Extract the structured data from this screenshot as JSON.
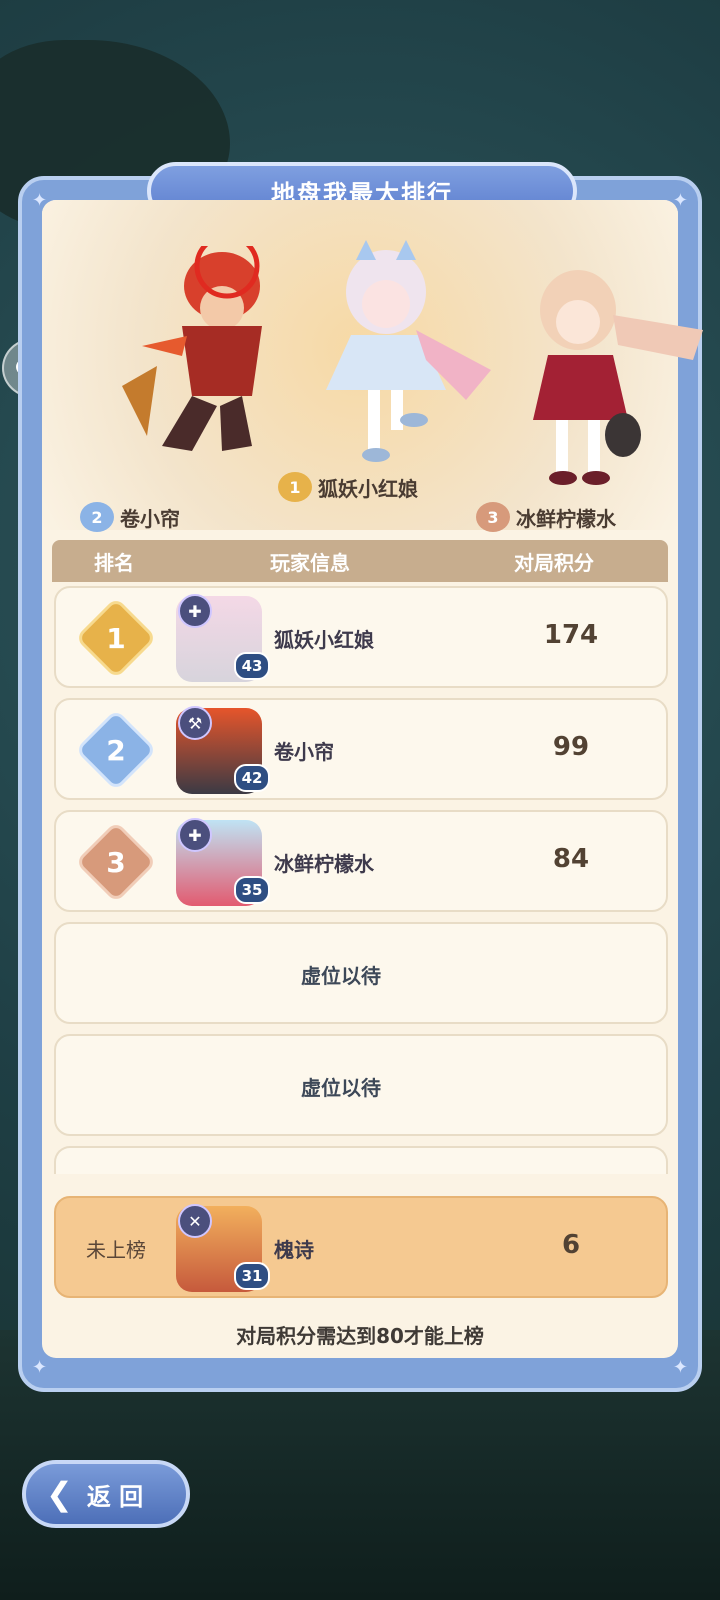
{
  "title": "地盘我最大排行",
  "podium": [
    {
      "rank": "1",
      "name": "狐妖小红娘"
    },
    {
      "rank": "2",
      "name": "卷小帘"
    },
    {
      "rank": "3",
      "name": "冰鲜柠檬水"
    }
  ],
  "table_header": {
    "rank": "排名",
    "player": "玩家信息",
    "score": "对局积分"
  },
  "rows": [
    {
      "rank": "1",
      "level": "43",
      "name": "狐妖小红娘",
      "score": "174"
    },
    {
      "rank": "2",
      "level": "42",
      "name": "卷小帘",
      "score": "99"
    },
    {
      "rank": "3",
      "level": "35",
      "name": "冰鲜柠檬水",
      "score": "84"
    }
  ],
  "placeholders": [
    "虚位以待",
    "虚位以待"
  ],
  "self": {
    "label": "未上榜",
    "level": "31",
    "name": "槐诗",
    "score": "6"
  },
  "requirement": "对局积分需达到80才能上榜",
  "back_label": "返 回",
  "icons": {
    "chat": "chat-bubble-icon",
    "back": "back-arrow-icon"
  },
  "colors": {
    "gold": "#e7b24a",
    "silver": "#8bb3e6",
    "bronze": "#d79a7b",
    "panel": "#7fa2d9"
  }
}
